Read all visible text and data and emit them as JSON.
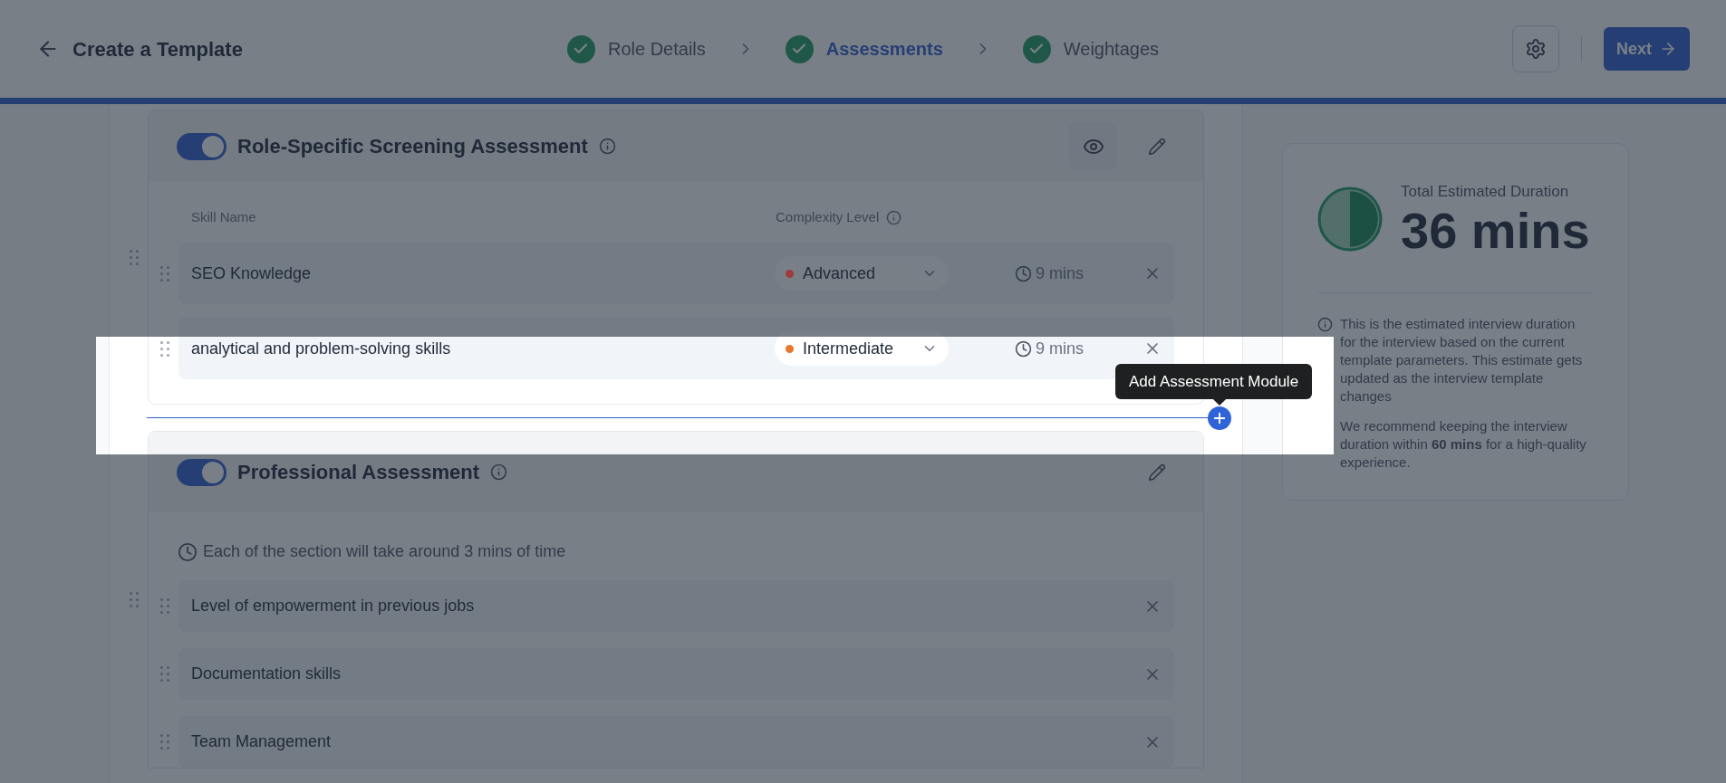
{
  "header": {
    "title": "Create a Template",
    "next_button": "Next"
  },
  "steps": [
    {
      "label": "Role Details",
      "done": true,
      "selected": false
    },
    {
      "label": "Assessments",
      "done": true,
      "selected": true
    },
    {
      "label": "Weightages",
      "done": true,
      "selected": false
    }
  ],
  "modules": [
    {
      "kind": "skills",
      "title": "Role-Specific Screening Assessment",
      "enabled": true,
      "columns": [
        "Skill Name",
        "Complexity Level"
      ],
      "rows": [
        {
          "name": "SEO Knowledge",
          "level_label": "Advanced",
          "color": "#9e3b3b",
          "duration": "9 mins"
        },
        {
          "name": "analytical and problem-solving skills",
          "level_label": "Intermediate",
          "color": "#e8772e",
          "duration": "9 mins"
        }
      ]
    },
    {
      "kind": "sections",
      "title": "Professional Assessment",
      "enabled": true,
      "note": "Each of the section will take around 3 mins of time",
      "rows": [
        {
          "name": "Level of empowerment in previous jobs"
        },
        {
          "name": "Documentation skills"
        },
        {
          "name": "Team Management"
        }
      ]
    }
  ],
  "add_module": {
    "tooltip": "Add Assessment Module"
  },
  "summary": {
    "label": "Total Estimated Duration",
    "value": "36 mins",
    "level": 0.5,
    "note": "This is the estimated interview duration for the interview based on the current template parameters. This estimate gets updated as the interview template changes",
    "recommendation": "We recommend keeping the interview duration within **60 mins** for a high-quality experience."
  }
}
